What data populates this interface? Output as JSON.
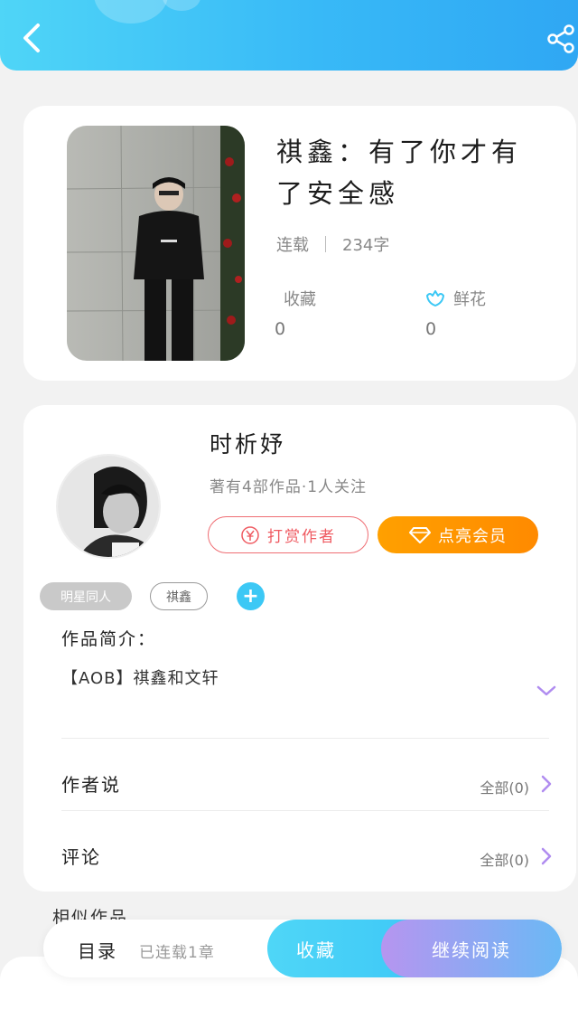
{
  "book": {
    "title": "祺鑫：有了你才有了安全感",
    "status": "连载",
    "word_count": "234字",
    "favorites_label": "收藏",
    "favorites_count": "0",
    "flowers_label": "鲜花",
    "flowers_count": "0"
  },
  "author": {
    "name": "时析妤",
    "stats": "著有4部作品·1人关注",
    "reward_label": "打赏作者",
    "vip_label": "点亮会员"
  },
  "tags": [
    "明星同人",
    "祺鑫"
  ],
  "intro": {
    "label": "作品简介：",
    "text": "【AOB】祺鑫和文轩"
  },
  "author_says": {
    "label": "作者说",
    "link": "全部(0)"
  },
  "comments": {
    "label": "评论",
    "link": "全部(0)"
  },
  "similar_label": "相似作品",
  "bottom_bar": {
    "toc_label": "目录",
    "serial_text": "已连载1章",
    "collect_label": "收藏",
    "read_label": "继续阅读"
  },
  "colors": {
    "header_start": "#4fd5f7",
    "header_end": "#2fa7f3",
    "reward_red": "#ef5a61",
    "vip_orange": "#ff9800",
    "accent_purple": "#b08cf0"
  }
}
